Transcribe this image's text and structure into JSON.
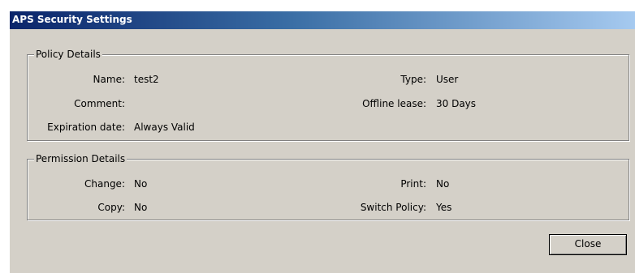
{
  "window": {
    "title": "APS Security Settings"
  },
  "policy": {
    "legend": "Policy Details",
    "name_label": "Name:",
    "name_value": "test2",
    "type_label": "Type:",
    "type_value": "User",
    "comment_label": "Comment:",
    "comment_value": "",
    "lease_label": "Offline lease:",
    "lease_value": "30 Days",
    "expiration_label": "Expiration date:",
    "expiration_value": "Always Valid"
  },
  "permission": {
    "legend": "Permission Details",
    "change_label": "Change:",
    "change_value": "No",
    "print_label": "Print:",
    "print_value": "No",
    "copy_label": "Copy:",
    "copy_value": "No",
    "switch_label": "Switch Policy:",
    "switch_value": "Yes"
  },
  "buttons": {
    "close_label": "Close"
  }
}
